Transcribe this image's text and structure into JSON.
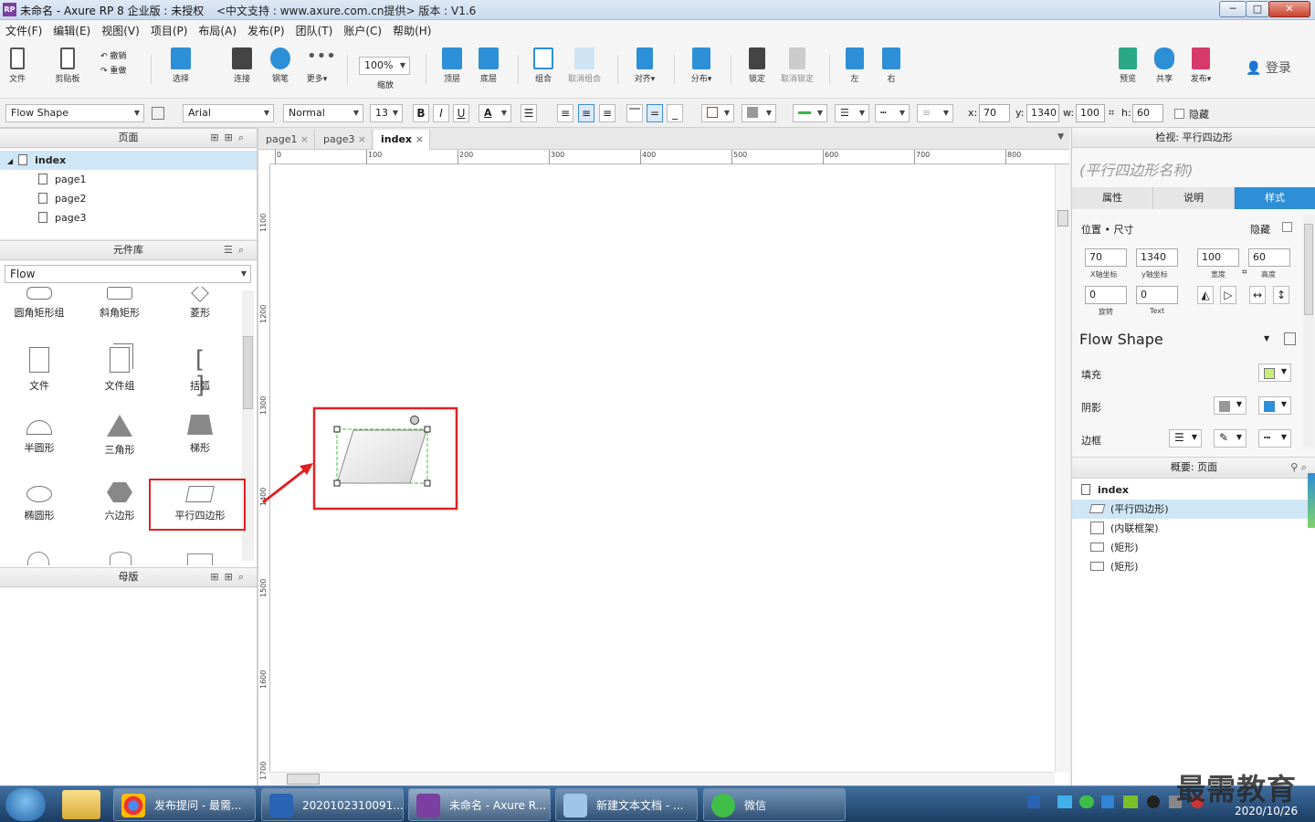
{
  "window": {
    "title": "未命名 - Axure RP 8 企业版 : 未授权",
    "subtitle": "<中文支持 : www.axure.com.cn提供> 版本 : V1.6",
    "logo_text": "RP",
    "minimize_label": "─",
    "maximize_label": "□",
    "close_label": "✕"
  },
  "menu": [
    "文件(F)",
    "编辑(E)",
    "视图(V)",
    "项目(P)",
    "布局(A)",
    "发布(P)",
    "团队(T)",
    "账户(C)",
    "帮助(H)"
  ],
  "toolbar": {
    "file": "文件",
    "clipboard": "剪贴板",
    "undo": "撤销",
    "redo": "重做",
    "select": "选择",
    "connect": "连接",
    "pen": "钢笔",
    "more": "更多▾",
    "zoom_value": "100%",
    "zoom_label": "缩放",
    "top_layer": "顶层",
    "bottom_layer": "底层",
    "group": "组合",
    "ungroup": "取消组合",
    "align": "对齐▾",
    "distribute": "分布▾",
    "lock": "锁定",
    "unlock": "取消锁定",
    "left": "左",
    "right": "右",
    "preview": "预览",
    "share": "共享",
    "publish": "发布▾",
    "login": "登录"
  },
  "format": {
    "style": "Flow Shape",
    "font": "Arial",
    "weight": "Normal",
    "size": "13",
    "bold": "B",
    "italic": "I",
    "underline": "U",
    "font_color": "A",
    "x_label": "x:",
    "x": "70",
    "y_label": "y:",
    "y": "1340",
    "w_label": "w:",
    "w": "100",
    "h_label": "h:",
    "h": "60",
    "hidden_label": "隐藏"
  },
  "pages_panel": {
    "title": "页面",
    "root": "index",
    "pages": [
      "page1",
      "page2",
      "page3"
    ]
  },
  "library_panel": {
    "title": "元件库",
    "selected_library": "Flow",
    "items": [
      {
        "label": "圆角矩形组"
      },
      {
        "label": "斜角矩形"
      },
      {
        "label": "菱形"
      },
      {
        "label": "文件"
      },
      {
        "label": "文件组"
      },
      {
        "label": "括弧"
      },
      {
        "label": "半圆形"
      },
      {
        "label": "三角形"
      },
      {
        "label": "梯形"
      },
      {
        "label": "椭圆形"
      },
      {
        "label": "六边形"
      },
      {
        "label": "平行四边形"
      }
    ]
  },
  "masters_panel": {
    "title": "母版"
  },
  "canvas": {
    "tabs": [
      {
        "label": "page1"
      },
      {
        "label": "page3"
      },
      {
        "label": "index"
      }
    ],
    "ruler_top": [
      "0",
      "100",
      "200",
      "300",
      "400",
      "500",
      "600",
      "700",
      "800"
    ],
    "ruler_left": [
      "1100",
      "1200",
      "1300",
      "1400",
      "1500",
      "1600",
      "1700"
    ],
    "highlight_color": "#e02020",
    "selection_color": "#33cc33"
  },
  "inspector": {
    "header": "检视: 平行四边形",
    "name_placeholder": "(平行四边形名称)",
    "tabs": [
      "属性",
      "说明",
      "样式"
    ],
    "active_tab": "样式",
    "section_position": "位置 • 尺寸",
    "hidden_label": "隐藏",
    "x": "70",
    "x_label": "X轴坐标",
    "y": "1340",
    "y_label": "y轴坐标",
    "w": "100",
    "w_label": "宽度",
    "h": "60",
    "h_label": "高度",
    "rotate": "0",
    "rotate_label": "旋转",
    "text_rotate": "0",
    "text_rotate_label": "Text",
    "style_name": "Flow Shape",
    "fill_label": "填充",
    "shadow_label": "阴影",
    "border_label": "边框",
    "fill_color": "#c6f07a",
    "shadow_color": "#2d8fd6"
  },
  "outline": {
    "header": "概要: 页面",
    "root": "index",
    "items": [
      "(平行四边形)",
      "(内联框架)",
      "(矩形)",
      "(矩形)"
    ]
  },
  "taskbar": {
    "tasks": [
      "发布提问 - 最需...",
      "2020102310091...",
      "未命名 - Axure R...",
      "新建文本文档 - ...",
      "微信"
    ],
    "watermark": "最需教育",
    "date": "2020/10/26"
  }
}
